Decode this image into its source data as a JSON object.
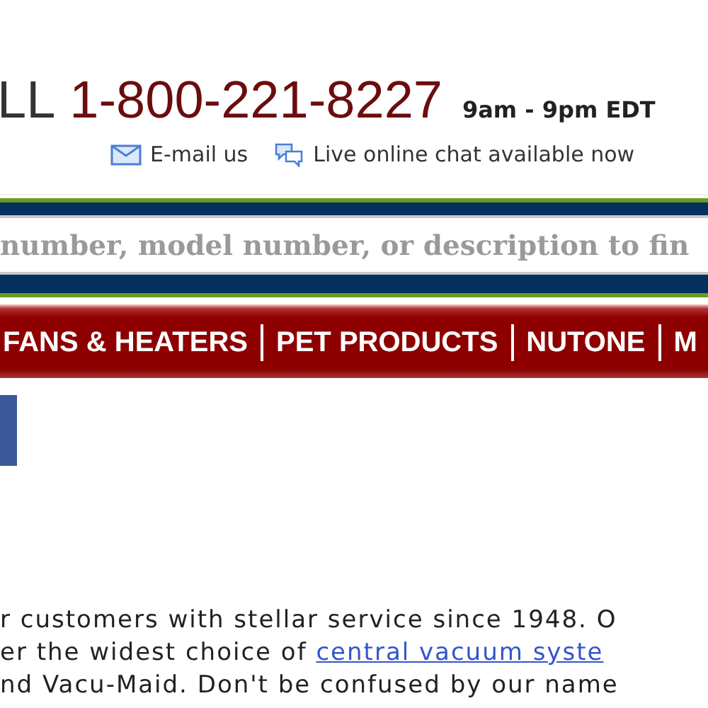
{
  "header": {
    "call_prefix": "LL",
    "phone": "1-800-221-8227",
    "hours": "9am - 9pm EDT",
    "links": [
      {
        "kind": "email",
        "label": "E-mail us"
      },
      {
        "kind": "chat",
        "label": "Live online chat available now"
      }
    ]
  },
  "search": {
    "placeholder": "number, model number, or description to fin"
  },
  "nav": {
    "items": [
      "FANS & HEATERS",
      "PET PRODUCTS",
      "NUTONE",
      "M"
    ]
  },
  "intro": {
    "lines": [
      [
        {
          "kind": "text",
          "text": "r customers with stellar service since 1948. O"
        }
      ],
      [
        {
          "kind": "text",
          "text": "er the widest choice of "
        },
        {
          "kind": "link",
          "text": "central vacuum syste"
        }
      ],
      [
        {
          "kind": "text",
          "text": "nd Vacu-Maid. Don't be confused by our name"
        }
      ]
    ]
  }
}
